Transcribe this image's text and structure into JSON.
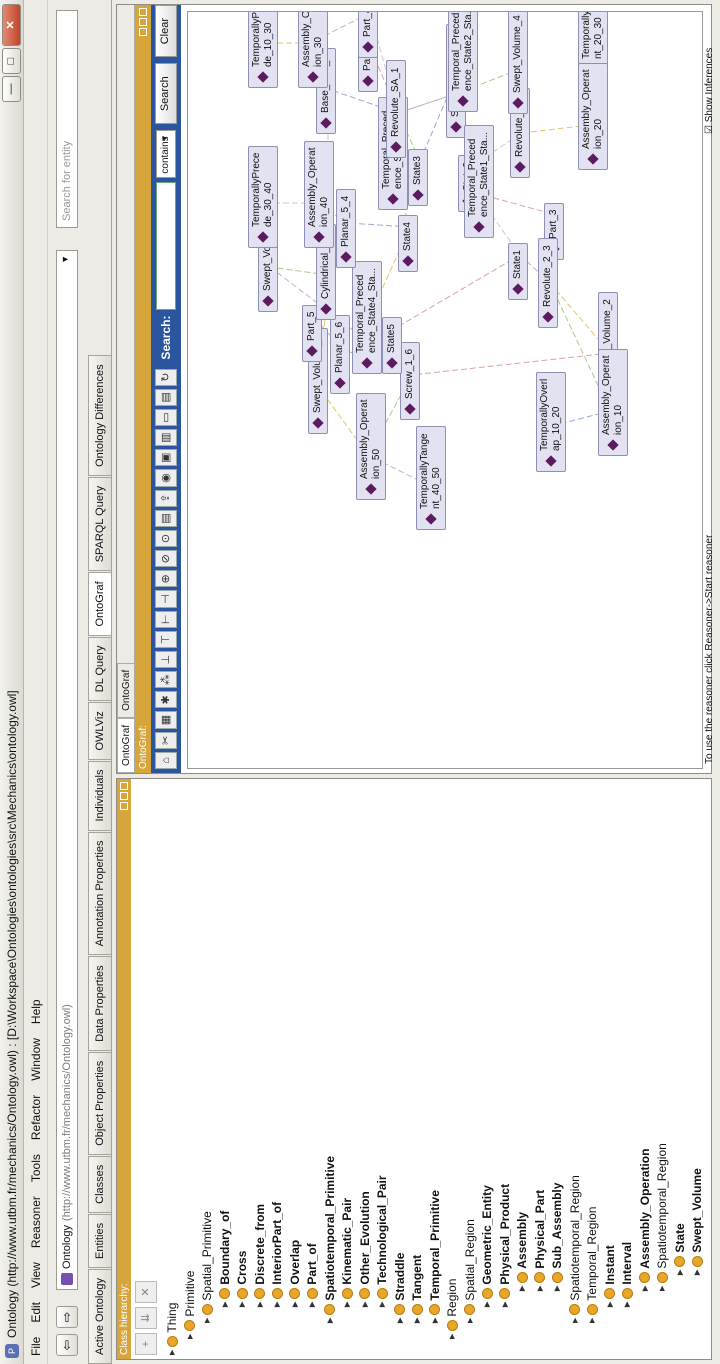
{
  "window": {
    "title": "Ontology (http://www.utbm.fr/mechanics/Ontology.owl) : [D:\\Workspace\\Ontologies\\ontologies\\src\\Mechanics\\ontology.owl]",
    "minimize": "—",
    "maximize": "□",
    "close": "✕"
  },
  "menu": [
    "File",
    "Edit",
    "View",
    "Reasoner",
    "Tools",
    "Refactor",
    "Window",
    "Help"
  ],
  "toolbar": {
    "back": "⇦",
    "forward": "⇨",
    "ontology_name": "Ontology",
    "ontology_iri": "(http://www.utbm.fr/mechanics/Ontology.owl)",
    "search_placeholder": "Search for entity"
  },
  "tabs": [
    "Active Ontology",
    "Entities",
    "Classes",
    "Object Properties",
    "Data Properties",
    "Annotation Properties",
    "Individuals",
    "OWLViz",
    "DL Query",
    "OntoGraf",
    "SPARQL Query",
    "Ontology Differences"
  ],
  "left": {
    "header": "Class hierarchy:",
    "tree": [
      {
        "label": "Thing",
        "depth": 0,
        "bold": false
      },
      {
        "label": "Primitive",
        "depth": 1,
        "bold": false
      },
      {
        "label": "Spatial_Primitive",
        "depth": 2,
        "bold": false
      },
      {
        "label": "Boundary_of",
        "depth": 3,
        "bold": true
      },
      {
        "label": "Cross",
        "depth": 3,
        "bold": true
      },
      {
        "label": "Discrete_from",
        "depth": 3,
        "bold": true
      },
      {
        "label": "InteriorPart_of",
        "depth": 3,
        "bold": true
      },
      {
        "label": "Overlap",
        "depth": 3,
        "bold": true
      },
      {
        "label": "Part_of",
        "depth": 3,
        "bold": true
      },
      {
        "label": "Spatiotemporal_Primitive",
        "depth": 2,
        "bold": true
      },
      {
        "label": "Kinematic_Pair",
        "depth": 3,
        "bold": true
      },
      {
        "label": "Other_Evolution",
        "depth": 3,
        "bold": true
      },
      {
        "label": "Technological_Pair",
        "depth": 3,
        "bold": true
      },
      {
        "label": "Straddle",
        "depth": 2,
        "bold": true
      },
      {
        "label": "Tangent",
        "depth": 2,
        "bold": true
      },
      {
        "label": "Temporal_Primitive",
        "depth": 2,
        "bold": true
      },
      {
        "label": "Region",
        "depth": 1,
        "bold": false
      },
      {
        "label": "Spatial_Region",
        "depth": 2,
        "bold": false
      },
      {
        "label": "Geometric_Entity",
        "depth": 3,
        "bold": true
      },
      {
        "label": "Physical_Product",
        "depth": 3,
        "bold": true
      },
      {
        "label": "Assembly",
        "depth": 4,
        "bold": true
      },
      {
        "label": "Physical_Part",
        "depth": 4,
        "bold": true
      },
      {
        "label": "Sub_Assembly",
        "depth": 4,
        "bold": true
      },
      {
        "label": "Spatiotemporal_Region",
        "depth": 2,
        "bold": false
      },
      {
        "label": "Temporal_Region",
        "depth": 2,
        "bold": false
      },
      {
        "label": "Instant",
        "depth": 3,
        "bold": true
      },
      {
        "label": "Interval",
        "depth": 3,
        "bold": true
      },
      {
        "label": "Assembly_Operation",
        "depth": 4,
        "bold": true
      },
      {
        "label": "Spatiotemporal_Region",
        "depth": 4,
        "bold": false
      },
      {
        "label": "State",
        "depth": 5,
        "bold": true
      },
      {
        "label": "Swept_Volume",
        "depth": 5,
        "bold": true
      }
    ]
  },
  "right": {
    "subtabs": [
      "OntoGraf",
      "OntoGraf"
    ],
    "header": "OntoGraf:",
    "search_label": "Search:",
    "match_mode": "contains",
    "search_button": "Search",
    "clear_button": "Clear"
  },
  "graph": {
    "nodes": [
      {
        "id": "n1",
        "label": [
          "TemporallyTange",
          "nt_40_50"
        ]
      },
      {
        "id": "n2",
        "label": [
          "Assembly_Operat",
          "ion_50"
        ]
      },
      {
        "id": "n3",
        "label": [
          "Swept_Volume_6"
        ]
      },
      {
        "id": "n4",
        "label": [
          "Screw_1_6"
        ]
      },
      {
        "id": "n5",
        "label": [
          "Planar_5_6"
        ]
      },
      {
        "id": "n6",
        "label": [
          "Part_5"
        ]
      },
      {
        "id": "n7",
        "label": [
          "State5"
        ]
      },
      {
        "id": "n8",
        "label": [
          "Temporal_Preced",
          "ence_State4_Sta..."
        ]
      },
      {
        "id": "n9",
        "label": [
          "Cylindrical_1_5"
        ]
      },
      {
        "id": "n10",
        "label": [
          "Swept_Volume_5"
        ]
      },
      {
        "id": "n11",
        "label": [
          "State4"
        ]
      },
      {
        "id": "n12",
        "label": [
          "Planar_5_4"
        ]
      },
      {
        "id": "n13",
        "label": [
          "Assembly_Operat",
          "ion_40"
        ]
      },
      {
        "id": "n14",
        "label": [
          "TemporallyPrece",
          "de_30_40"
        ]
      },
      {
        "id": "n15",
        "label": [
          "Temporal_Preced",
          "ence_State3_Sta..."
        ]
      },
      {
        "id": "n16",
        "label": [
          "State3"
        ]
      },
      {
        "id": "n17",
        "label": [
          "Revolute_SA_1"
        ]
      },
      {
        "id": "n18",
        "label": [
          "Base_Part_1"
        ]
      },
      {
        "id": "n19",
        "label": [
          "Part_2"
        ]
      },
      {
        "id": "n20",
        "label": [
          "Part_4"
        ]
      },
      {
        "id": "n21",
        "label": [
          "Assembly_Operat",
          "ion_30"
        ]
      },
      {
        "id": "n22",
        "label": [
          "TemporallyPrece",
          "de_10_30"
        ]
      },
      {
        "id": "n23",
        "label": [
          "Sub_Assembly_SA"
        ]
      },
      {
        "id": "n24",
        "label": [
          "Temporal_Preced",
          "ence_State2_Sta..."
        ]
      },
      {
        "id": "n25",
        "label": [
          "State2"
        ]
      },
      {
        "id": "n26",
        "label": [
          "Revolute_4_3"
        ]
      },
      {
        "id": "n27",
        "label": [
          "Swept_Volume_4"
        ]
      },
      {
        "id": "n28",
        "label": [
          "TemporallyTange",
          "nt_20_30"
        ]
      },
      {
        "id": "n29",
        "label": [
          "Assembly_Operat",
          "ion_20"
        ]
      },
      {
        "id": "n30",
        "label": [
          "Temporal_Preced",
          "ence_State1_Sta..."
        ]
      },
      {
        "id": "n31",
        "label": [
          "Part_3"
        ]
      },
      {
        "id": "n32",
        "label": [
          "State1"
        ]
      },
      {
        "id": "n33",
        "label": [
          "Revolute_2_3"
        ]
      },
      {
        "id": "n34",
        "label": [
          "Swept_Volume_2"
        ]
      },
      {
        "id": "n35",
        "label": [
          "Assembly_Operat",
          "ion_10"
        ]
      },
      {
        "id": "n36",
        "label": [
          "TemporallyOverl",
          "ap_10_20"
        ]
      }
    ]
  },
  "status": {
    "text": "To use the reasoner click Reasoner->Start reasoner",
    "show_inferences": "Show Inferences"
  }
}
